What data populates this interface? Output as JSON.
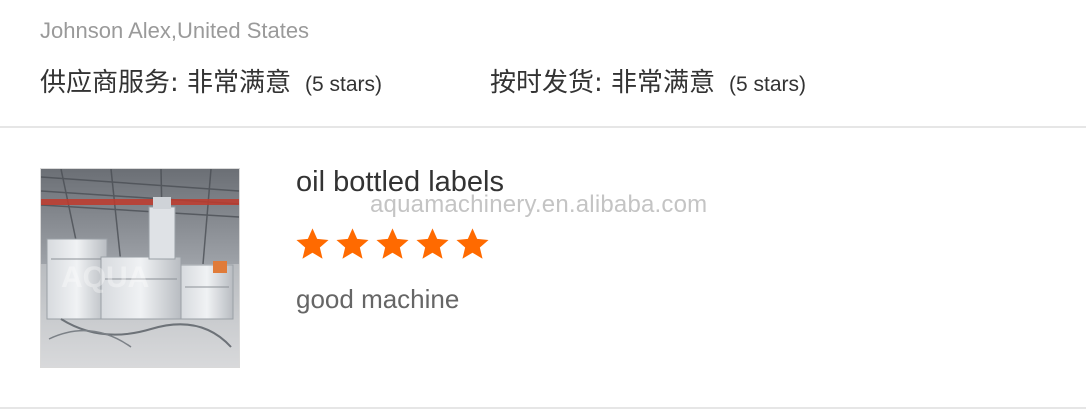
{
  "review": {
    "reviewer": "Johnson Alex,United States",
    "supplier_service": {
      "label": "供应商服务: 非常满意",
      "stars_text": "(5 stars)"
    },
    "on_time_delivery": {
      "label": "按时发货: 非常满意",
      "stars_text": "(5 stars)"
    },
    "product": {
      "title": "oil bottled labels",
      "watermark": "aquamachinery.en.alibaba.com",
      "image_watermark": "AQUA",
      "rating": 5,
      "rating_max": 5,
      "comment": "good machine"
    }
  },
  "colors": {
    "star": "#ff6a00",
    "divider": "#e6e6e6",
    "reviewer_text": "#9a9a9a",
    "title_text": "#333333",
    "comment_text": "#666666"
  },
  "icons": {
    "star": "star-icon"
  }
}
